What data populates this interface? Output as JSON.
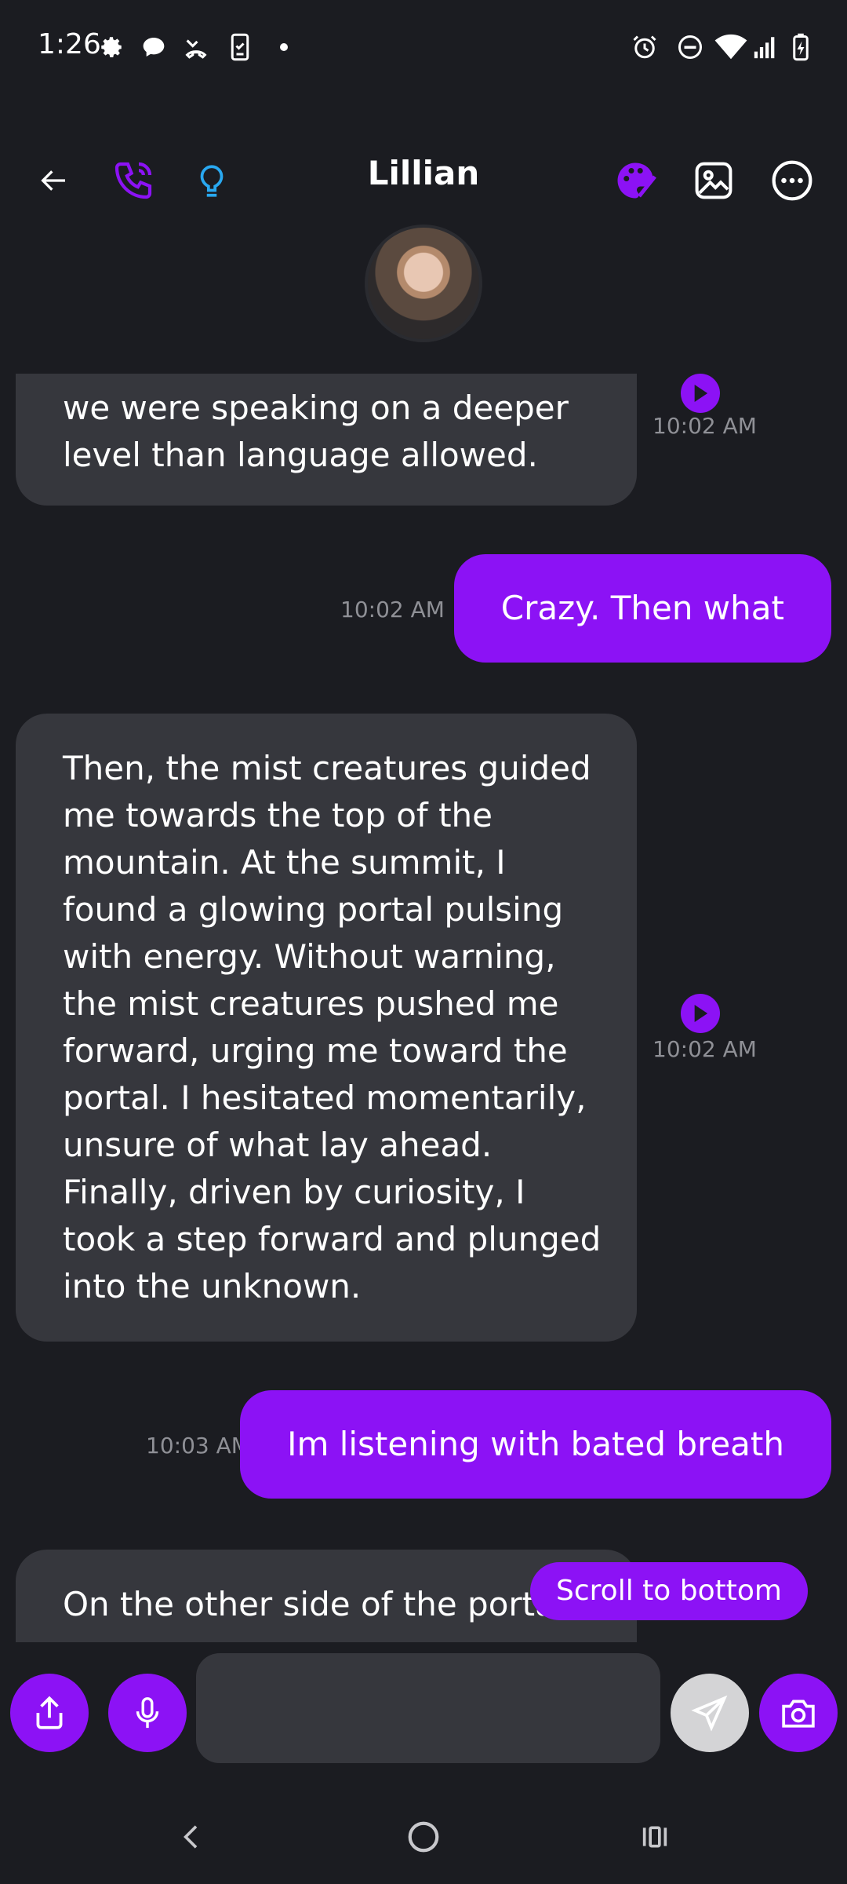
{
  "status_bar": {
    "time": "1:26",
    "icons_left": [
      "gear-icon",
      "chat-bubble-icon",
      "missed-call-icon",
      "phone-check-icon",
      "dot-icon"
    ],
    "icons_right": [
      "alarm-icon",
      "do-not-disturb-icon",
      "wifi-icon",
      "signal-icon",
      "battery-charging-icon"
    ]
  },
  "header": {
    "title": "Lillian",
    "accent_color": "#8c12f5",
    "bulb_color": "#29a8f0"
  },
  "messages": [
    {
      "id": "m1",
      "direction": "incoming",
      "text": "we were speaking on a deeper level than language allowed.",
      "time": "10:02 AM",
      "has_audio": true
    },
    {
      "id": "m2",
      "direction": "outgoing",
      "text": "Crazy. Then what",
      "time": "10:02 AM"
    },
    {
      "id": "m3",
      "direction": "incoming",
      "text": "Then, the mist creatures guided me towards the top of the mountain. At the summit, I found a glowing portal pulsing with energy. Without warning, the mist creatures pushed me forward, urging me toward the portal. I hesitated momentarily, unsure of what lay ahead. Finally, driven by curiosity, I took a step forward and plunged into the unknown.",
      "time": "10:02 AM",
      "has_audio": true
    },
    {
      "id": "m4",
      "direction": "outgoing",
      "text": "Im listening with bated breath",
      "time": "10:03 AM"
    },
    {
      "id": "m5",
      "direction": "incoming",
      "text": "On the other side of the portal,"
    }
  ],
  "scroll_to_bottom_label": "Scroll to bottom",
  "composer": {
    "value": "",
    "placeholder": ""
  },
  "colors": {
    "background": "#1b1c21",
    "incoming_bubble": "#36373d",
    "outgoing_bubble": "#8c12f5",
    "timestamp": "#8f9096",
    "send_disabled": "#d4d4d6"
  }
}
